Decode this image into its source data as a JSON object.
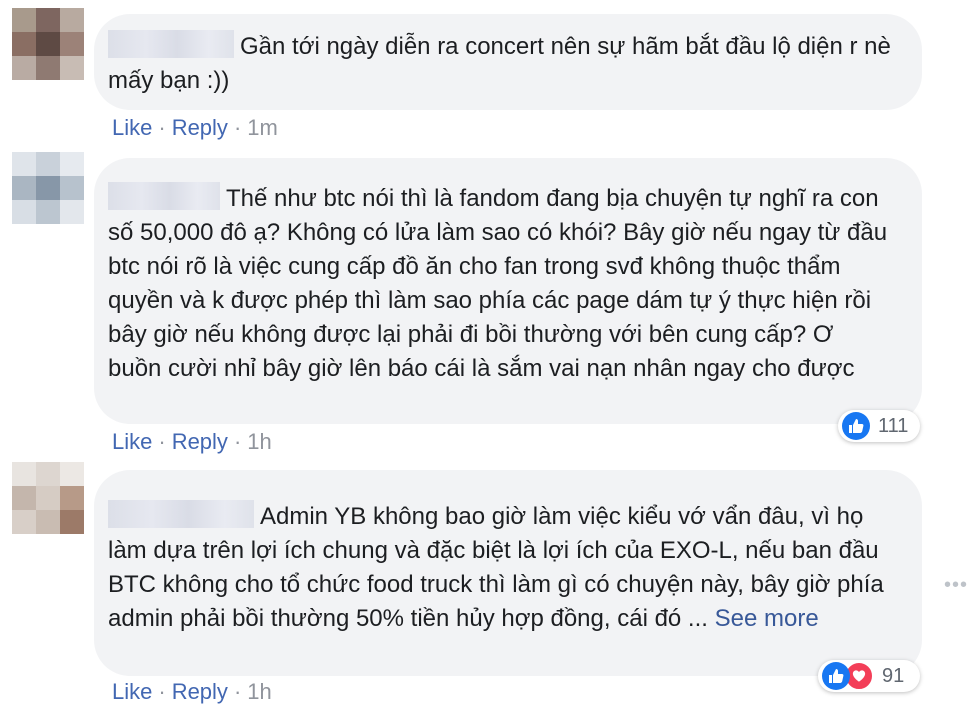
{
  "comments": [
    {
      "text": "Gần tới ngày diễn ra concert nên sự hãm bắt đầu lộ diện r nè mấy bạn :))",
      "like_label": "Like",
      "reply_label": "Reply",
      "time": "1m"
    },
    {
      "text": "Thế như btc nói thì là fandom đang bịa chuyện tự nghĩ ra con số 50,000 đô ạ? Không có lửa làm sao có khói? Bây giờ nếu ngay từ đầu btc nói rõ là việc cung cấp đồ ăn cho fan trong svđ không thuộc thẩm quyền và k được phép thì làm sao phía các page dám tự ý thực hiện rồi bây giờ nếu không được lại phải đi bồi thường với bên cung cấp? Ơ buồn cười nhỉ bây giờ lên báo cái là sắm vai nạn nhân ngay cho được",
      "like_label": "Like",
      "reply_label": "Reply",
      "time": "1h",
      "reaction_count": "111",
      "reaction_icons": [
        "like-icon"
      ]
    },
    {
      "text": "Admin YB không bao giờ làm việc kiểu vớ vẩn đâu, vì họ làm dựa trên lợi ích chung và đặc biệt là lợi ích của EXO-L, nếu ban đầu BTC không cho tổ chức food truck thì làm gì có chuyện này, bây giờ phía admin phải bồi thường 50% tiền hủy hợp đồng, cái đó ...",
      "see_more": "See more",
      "like_label": "Like",
      "reply_label": "Reply",
      "time": "1h",
      "reaction_count": "91",
      "reaction_icons": [
        "like-icon",
        "love-icon"
      ]
    }
  ],
  "more_options": "•••",
  "colors": {
    "link": "#4267b2",
    "bubble": "#f2f3f5",
    "meta": "#90949c",
    "like": "#1877f2",
    "love": "#f33e58"
  }
}
